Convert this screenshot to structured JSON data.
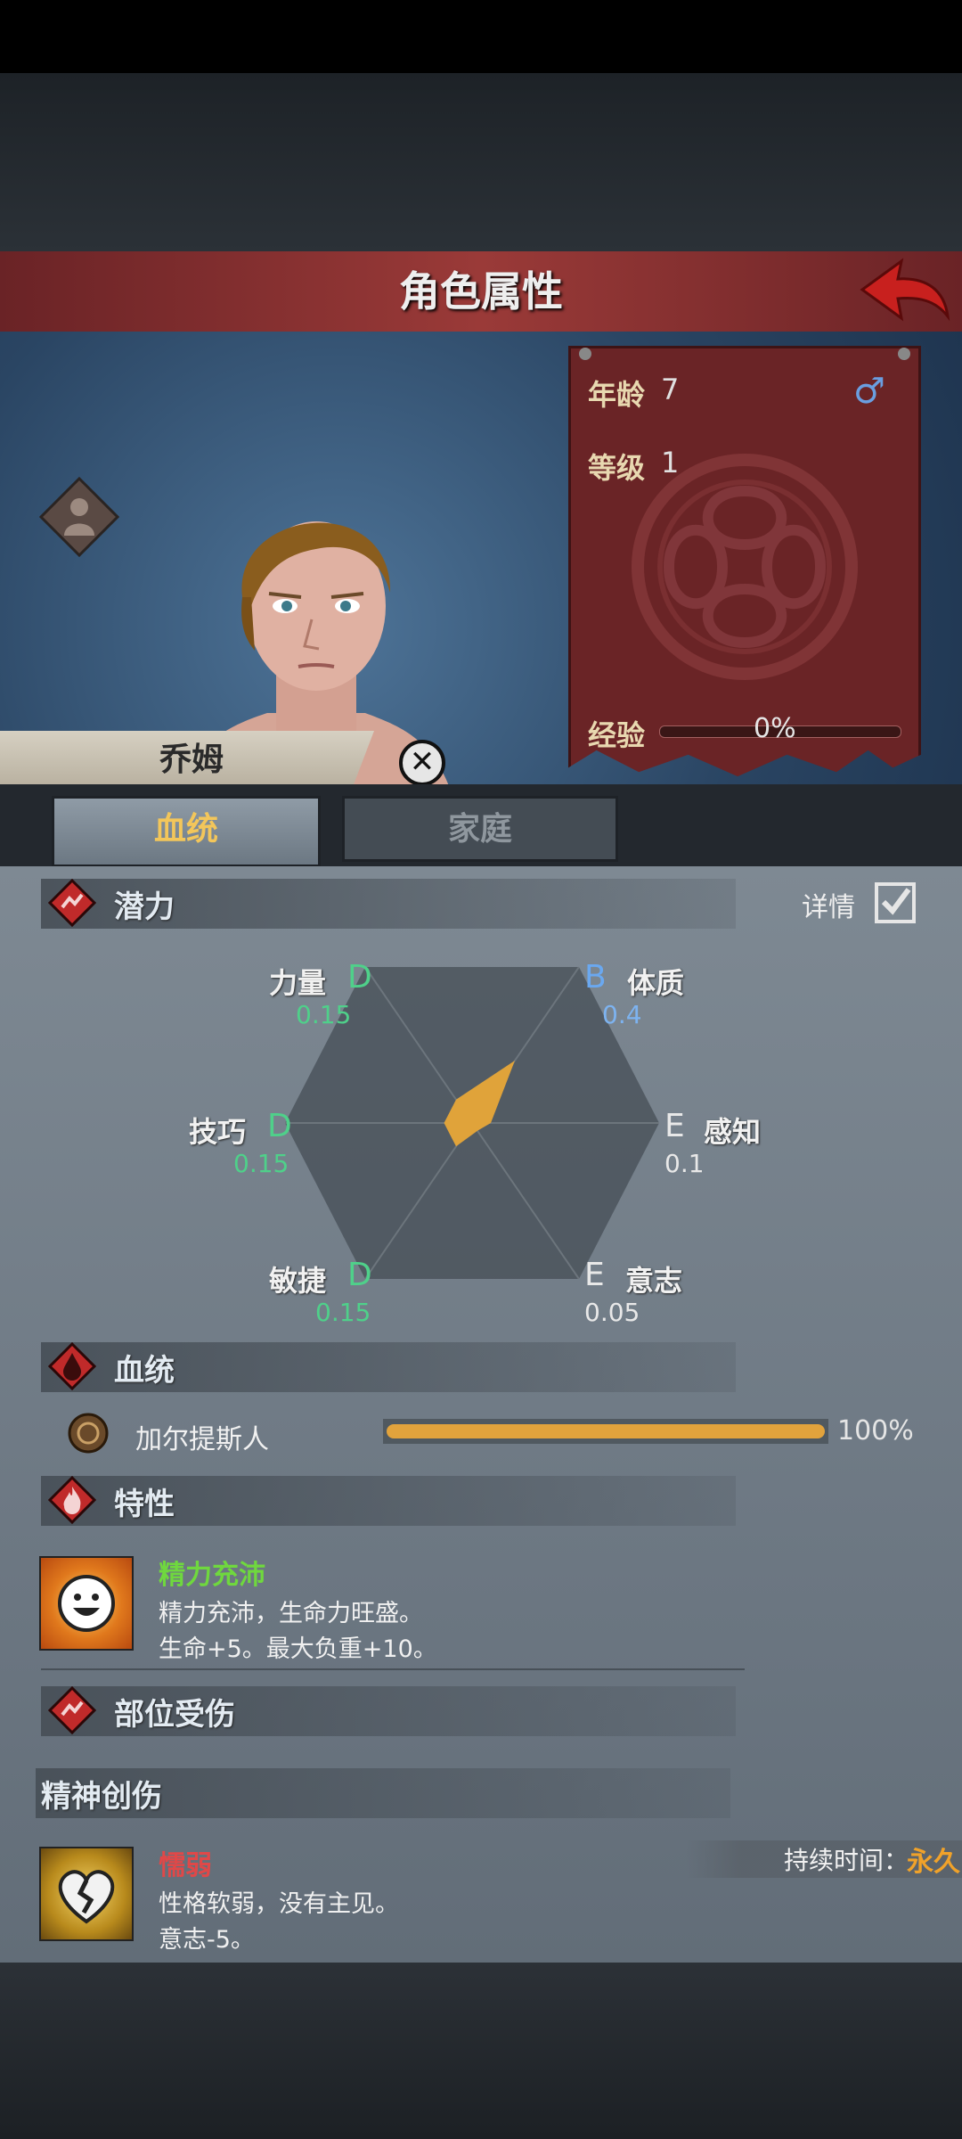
{
  "header": {
    "title": "角色属性"
  },
  "character": {
    "name": "乔姆"
  },
  "info_card": {
    "age_label": "年龄",
    "age_value": "7",
    "level_label": "等级",
    "level_value": "1",
    "xp_label": "经验",
    "xp_percent": "0%"
  },
  "tabs": [
    {
      "label": "血统",
      "active": true
    },
    {
      "label": "家庭",
      "active": false
    }
  ],
  "potential": {
    "title": "潜力",
    "detail_label": "详情",
    "detail_checked": true,
    "stats": [
      {
        "name": "力量",
        "grade": "D",
        "value": "0.15"
      },
      {
        "name": "体质",
        "grade": "B",
        "value": "0.4"
      },
      {
        "name": "感知",
        "grade": "E",
        "value": "0.1"
      },
      {
        "name": "意志",
        "grade": "E",
        "value": "0.05"
      },
      {
        "name": "敏捷",
        "grade": "D",
        "value": "0.15"
      },
      {
        "name": "技巧",
        "grade": "D",
        "value": "0.15"
      }
    ]
  },
  "bloodline": {
    "title": "血统",
    "entries": [
      {
        "name": "加尔提斯人",
        "percent": "100%",
        "fraction": 1.0
      }
    ]
  },
  "traits": {
    "title": "特性",
    "items": [
      {
        "name": "精力充沛",
        "desc1": "精力充沛，生命力旺盛。",
        "desc2": "生命+5。最大负重+10。"
      }
    ]
  },
  "injuries": {
    "title": "部位受伤",
    "mental_title": "精神创伤",
    "items": [
      {
        "name": "懦弱",
        "desc1": "性格软弱，没有主见。",
        "desc2": "意志-5。",
        "duration_label": "持续时间：",
        "duration_value": "永久"
      }
    ]
  },
  "colors": {
    "accent_red": "#c23a3a",
    "gold": "#e2a33c",
    "trait_green": "#6fd83e",
    "weakness_red": "#e04848"
  }
}
